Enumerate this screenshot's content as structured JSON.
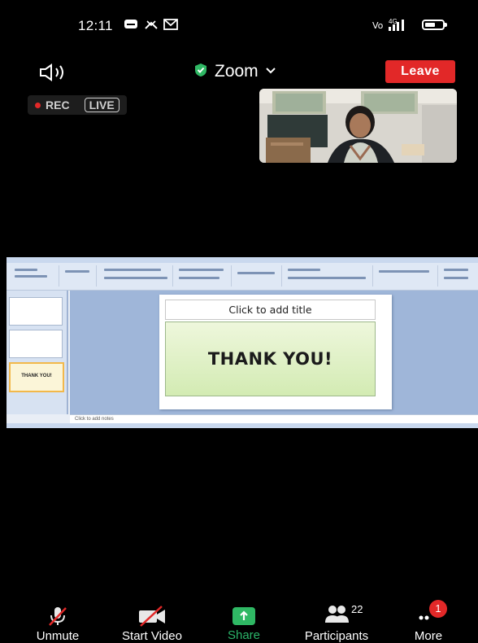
{
  "status_bar": {
    "time": "12:11",
    "network": "4G"
  },
  "header": {
    "meeting_title": "Zoom",
    "leave_label": "Leave"
  },
  "recording": {
    "rec_label": "REC",
    "live_label": "LIVE"
  },
  "slide": {
    "title_placeholder": "Click to add title",
    "body_text": "THANK YOU!",
    "notes_placeholder": "Click to add notes",
    "thumbnail_3_text": "THANK YOU!"
  },
  "toolbar": {
    "unmute": "Unmute",
    "start_video": "Start Video",
    "share": "Share",
    "participants": "Participants",
    "participants_count": "22",
    "more": "More",
    "more_badge": "1"
  },
  "colors": {
    "leave": "#e22828",
    "share_accent": "#2fb864",
    "shield": "#2fb864",
    "rec_dot": "#e22828"
  }
}
